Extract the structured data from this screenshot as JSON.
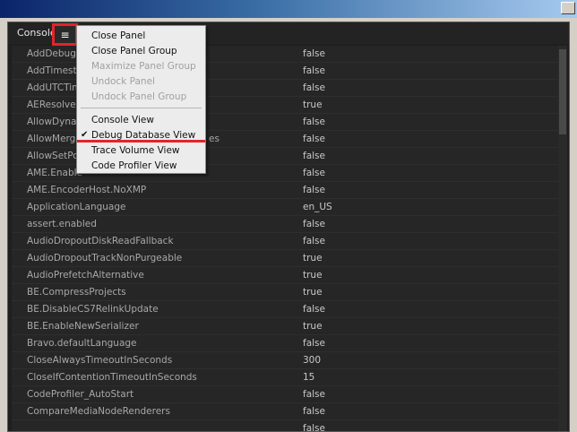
{
  "window": {
    "panel_tab": "Console",
    "menu_icon": "hamburger-menu-icon"
  },
  "flyout_menu": {
    "items": [
      {
        "label": "Close Panel",
        "enabled": true,
        "checked": false
      },
      {
        "label": "Close Panel Group",
        "enabled": true,
        "checked": false
      },
      {
        "label": "Maximize Panel Group",
        "enabled": false,
        "checked": false
      },
      {
        "label": "Undock Panel",
        "enabled": false,
        "checked": false
      },
      {
        "label": "Undock Panel Group",
        "enabled": false,
        "checked": false
      },
      {
        "label": "Console View",
        "enabled": true,
        "checked": false
      },
      {
        "label": "Debug Database View",
        "enabled": true,
        "checked": true
      },
      {
        "label": "Trace Volume View",
        "enabled": true,
        "checked": false
      },
      {
        "label": "Code Profiler View",
        "enabled": true,
        "checked": false
      }
    ],
    "check_glyph": "✔",
    "highlight_color": "#e3242b"
  },
  "debug_list": {
    "rows": [
      {
        "name": "AddDebugC",
        "value": "false"
      },
      {
        "name": "AddTimesta",
        "value": "false"
      },
      {
        "name": "AddUTCTim",
        "value": "false"
      },
      {
        "name": "AEResolve",
        "value": "true"
      },
      {
        "name": "AllowDyna",
        "value": "false"
      },
      {
        "name": "AllowMerge",
        "suffix": "es",
        "value": "false"
      },
      {
        "name": "AllowSetPo",
        "value": "false"
      },
      {
        "name": "AME.Enable",
        "value": "false"
      },
      {
        "name": "AME.EncoderHost.NoXMP",
        "value": "false"
      },
      {
        "name": "ApplicationLanguage",
        "value": "en_US"
      },
      {
        "name": "assert.enabled",
        "value": "false"
      },
      {
        "name": "AudioDropoutDiskReadFallback",
        "value": "false"
      },
      {
        "name": "AudioDropoutTrackNonPurgeable",
        "value": "true"
      },
      {
        "name": "AudioPrefetchAlternative",
        "value": "true"
      },
      {
        "name": "BE.CompressProjects",
        "value": "true"
      },
      {
        "name": "BE.DisableCS7RelinkUpdate",
        "value": "false"
      },
      {
        "name": "BE.EnableNewSerializer",
        "value": "true"
      },
      {
        "name": "Bravo.defaultLanguage",
        "value": "false"
      },
      {
        "name": "CloseAlwaysTimeoutInSeconds",
        "value": "300"
      },
      {
        "name": "CloseIfContentionTimeoutInSeconds",
        "value": "15"
      },
      {
        "name": "CodeProfiler_AutoStart",
        "value": "false"
      },
      {
        "name": "CompareMediaNodeRenderers",
        "value": "false"
      },
      {
        "name": "",
        "value": "false"
      }
    ]
  }
}
